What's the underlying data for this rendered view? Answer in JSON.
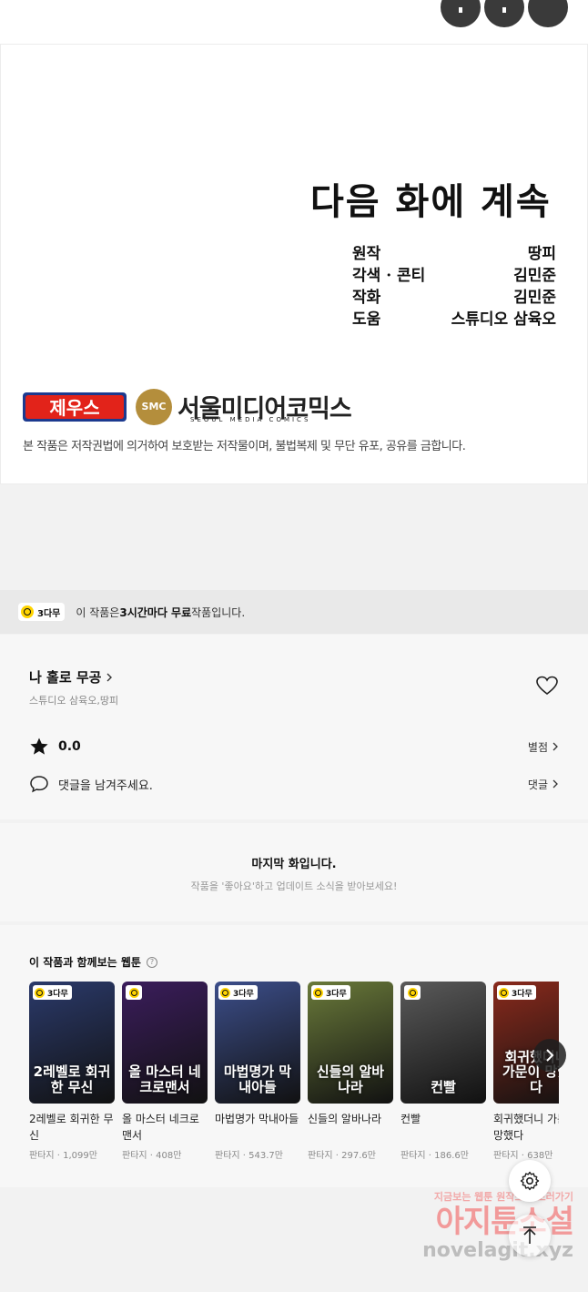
{
  "comic": {
    "next_title": "다음 화에 계속",
    "credits": [
      {
        "role": "원작",
        "name": "땅피"
      },
      {
        "role": "각색 · 콘티",
        "name": "김민준"
      },
      {
        "role": "작화",
        "name": "김민준"
      },
      {
        "role": "도움",
        "name": "스튜디오 삼육오"
      }
    ],
    "brand_zeus": "제우스",
    "brand_smc_mark": "SMC",
    "brand_smc": "서울미디어코믹스",
    "brand_smc_sub": "SEOUL MEDIA COMICS",
    "copyright": "본 작품은 저작권법에 의거하여 보호받는 저작물이며, 불법복제 및 무단 유포, 공유를 금합니다."
  },
  "free_banner": {
    "badge": "3다무",
    "text_prefix": "이 작품은 ",
    "text_bold": "3시간마다 무료",
    "text_suffix": " 작품입니다."
  },
  "series": {
    "title": "나 홀로 무공",
    "author": "스튜디오 삼육오,땅피",
    "rating": "0.0",
    "rating_link": "별점",
    "comment_placeholder": "댓글을 남겨주세요.",
    "comment_link": "댓글"
  },
  "last_episode": {
    "title": "마지막 화입니다.",
    "subtitle": "작품을 '좋아요'하고 업데이트 소식을 받아보세요!"
  },
  "recommendations": {
    "title": "이 작품과 함께보는 웹툰",
    "items": [
      {
        "title": "2레벨로 회귀한 무신",
        "meta": "판타지 · 1,099만",
        "badge": "3다무",
        "cover_text": "2레벨로 회귀한 무신",
        "bg": "#2b3a6b"
      },
      {
        "title": "올 마스터 네크로맨서",
        "meta": "판타지 · 408만",
        "badge": "",
        "cover_text": "올 마스터 네크로맨서",
        "bg": "#3b1d5c"
      },
      {
        "title": "마법명가 막내아들",
        "meta": "판타지 · 543.7만",
        "badge": "3다무",
        "cover_text": "마법명가 막내아들",
        "bg": "#3c4e8a"
      },
      {
        "title": "신들의 알바나라",
        "meta": "판타지 · 297.6만",
        "badge": "3다무",
        "cover_text": "신들의 알바나라",
        "bg": "#6a7a3a"
      },
      {
        "title": "컨빨",
        "meta": "판타지 · 186.6만",
        "badge": "",
        "cover_text": "컨빨",
        "bg": "#5a5a5a"
      },
      {
        "title": "회귀했더니 가문이 망했다",
        "meta": "판타지 · 638만",
        "badge": "3다무",
        "cover_text": "회귀했더니 가문이 망했다",
        "bg": "#8a2a1c"
      }
    ]
  },
  "watermark": {
    "line1": "지금보는 웹툰 원작소설 보러가기",
    "line2": "아지툰소설",
    "line3": "novelagit.xyz"
  }
}
